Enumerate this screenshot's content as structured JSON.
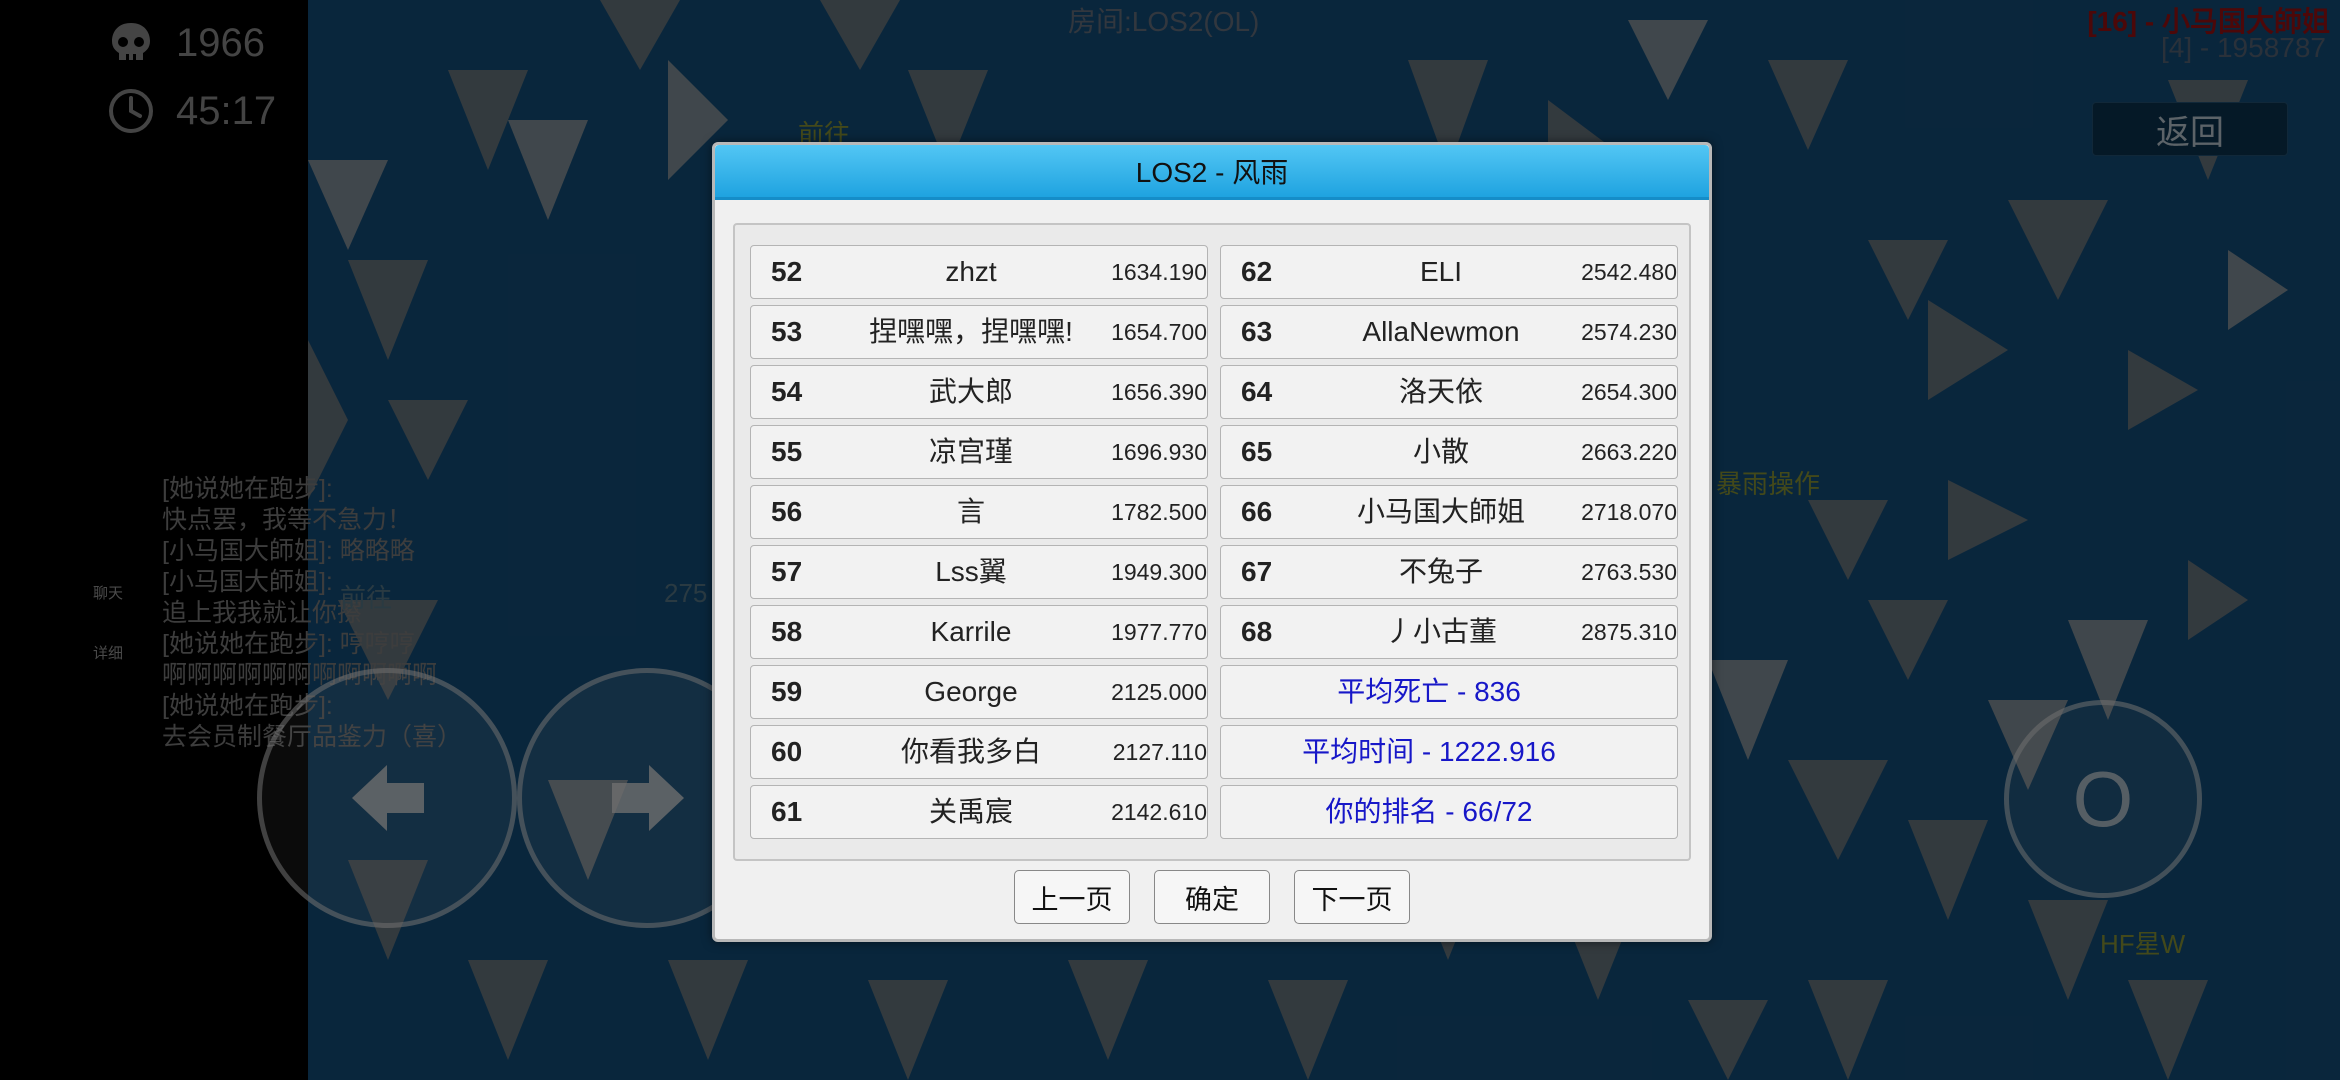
{
  "hud": {
    "deaths": "1966",
    "time": "45:17"
  },
  "top": {
    "room_title": "房间:LOS2(OL)",
    "player_tag": "[16] - 小马国大師姐",
    "player_sub": "[4] - 1958787"
  },
  "back_label": "返回",
  "side_labels": {
    "chat": "聊天",
    "detail": "详细"
  },
  "chat_lines": [
    "[她说她在跑步]:",
    "快点罢，我等不急力！",
    "[小马国大師姐]: 略略略",
    "[小马国大師姐]:",
    "追上我我就让你擦",
    "[她说她在跑步]: 哼哼哼",
    "啊啊啊啊啊啊啊啊啊啊啊",
    "[她说她在跑步]:",
    "去会员制餐厅品鉴力（喜）"
  ],
  "bg_labels": {
    "a": "前往",
    "b": "前往",
    "c": "275",
    "d": "暴雨操作",
    "e": "HF星W"
  },
  "action_label": "O",
  "dialog": {
    "title": "LOS2 - 风雨",
    "left_rows": [
      {
        "rank": "52",
        "name": "zhzt",
        "score": "1634.190"
      },
      {
        "rank": "53",
        "name": "捏嘿嘿，捏嘿嘿!",
        "score": "1654.700"
      },
      {
        "rank": "54",
        "name": "武大郎",
        "score": "1656.390"
      },
      {
        "rank": "55",
        "name": "凉宫瑾",
        "score": "1696.930"
      },
      {
        "rank": "56",
        "name": "言",
        "score": "1782.500"
      },
      {
        "rank": "57",
        "name": "Lss翼",
        "score": "1949.300"
      },
      {
        "rank": "58",
        "name": "Karrile",
        "score": "1977.770"
      },
      {
        "rank": "59",
        "name": "George",
        "score": "2125.000"
      },
      {
        "rank": "60",
        "name": "你看我多白",
        "score": "2127.110"
      },
      {
        "rank": "61",
        "name": "关禹宸",
        "score": "2142.610"
      }
    ],
    "right_rows": [
      {
        "rank": "62",
        "name": "ELI",
        "score": "2542.480"
      },
      {
        "rank": "63",
        "name": "AllaNewmon",
        "score": "2574.230"
      },
      {
        "rank": "64",
        "name": "洛天依",
        "score": "2654.300"
      },
      {
        "rank": "65",
        "name": "小散",
        "score": "2663.220"
      },
      {
        "rank": "66",
        "name": "小马国大師姐",
        "score": "2718.070"
      },
      {
        "rank": "67",
        "name": "不兔子",
        "score": "2763.530"
      },
      {
        "rank": "68",
        "name": "丿小古董",
        "score": "2875.310"
      }
    ],
    "stats": [
      "平均死亡 - 836",
      "平均时间 - 1222.916",
      "你的排名 - 66/72"
    ],
    "buttons": {
      "prev": "上一页",
      "ok": "确定",
      "next": "下一页"
    }
  }
}
